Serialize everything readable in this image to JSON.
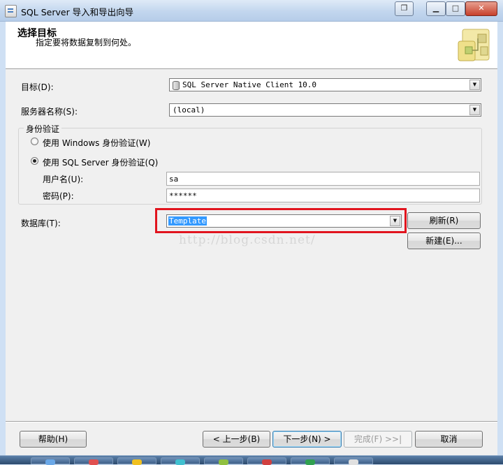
{
  "window": {
    "title": "SQL Server 导入和导出向导"
  },
  "header": {
    "title": "选择目标",
    "subtitle": "指定要将数据复制到何处。"
  },
  "form": {
    "destination": {
      "label": "目标(D):",
      "value": "SQL Server Native Client 10.0"
    },
    "server": {
      "label": "服务器名称(S):",
      "value": "(local)"
    },
    "auth": {
      "legend": "身份验证",
      "windows_label": "使用 Windows 身份验证(W)",
      "sql_label": "使用 SQL Server 身份验证(Q)",
      "selected": "sql",
      "username_label": "用户名(U):",
      "username_value": "sa",
      "password_label": "密码(P):",
      "password_value": "******"
    },
    "database": {
      "label": "数据库(T):",
      "value": "Template"
    },
    "refresh_label": "刷新(R)",
    "new_label": "新建(E)..."
  },
  "watermark": "http://blog.csdn.net/",
  "footer": {
    "help": "帮助(H)",
    "back": "< 上一步(B)",
    "next": "下一步(N) >",
    "finish": "完成(F) >>|",
    "cancel": "取消"
  },
  "colors": {
    "highlight": "#e1141e",
    "selection": "#3399ff",
    "client_bg": "#f0f0f0"
  },
  "taskbar": {
    "item_colors": [
      "#6aa8e8",
      "#e05050",
      "#f0c020",
      "#40c0d0",
      "#90c040",
      "#d04040",
      "#30a050",
      "#e0e0e0"
    ]
  }
}
